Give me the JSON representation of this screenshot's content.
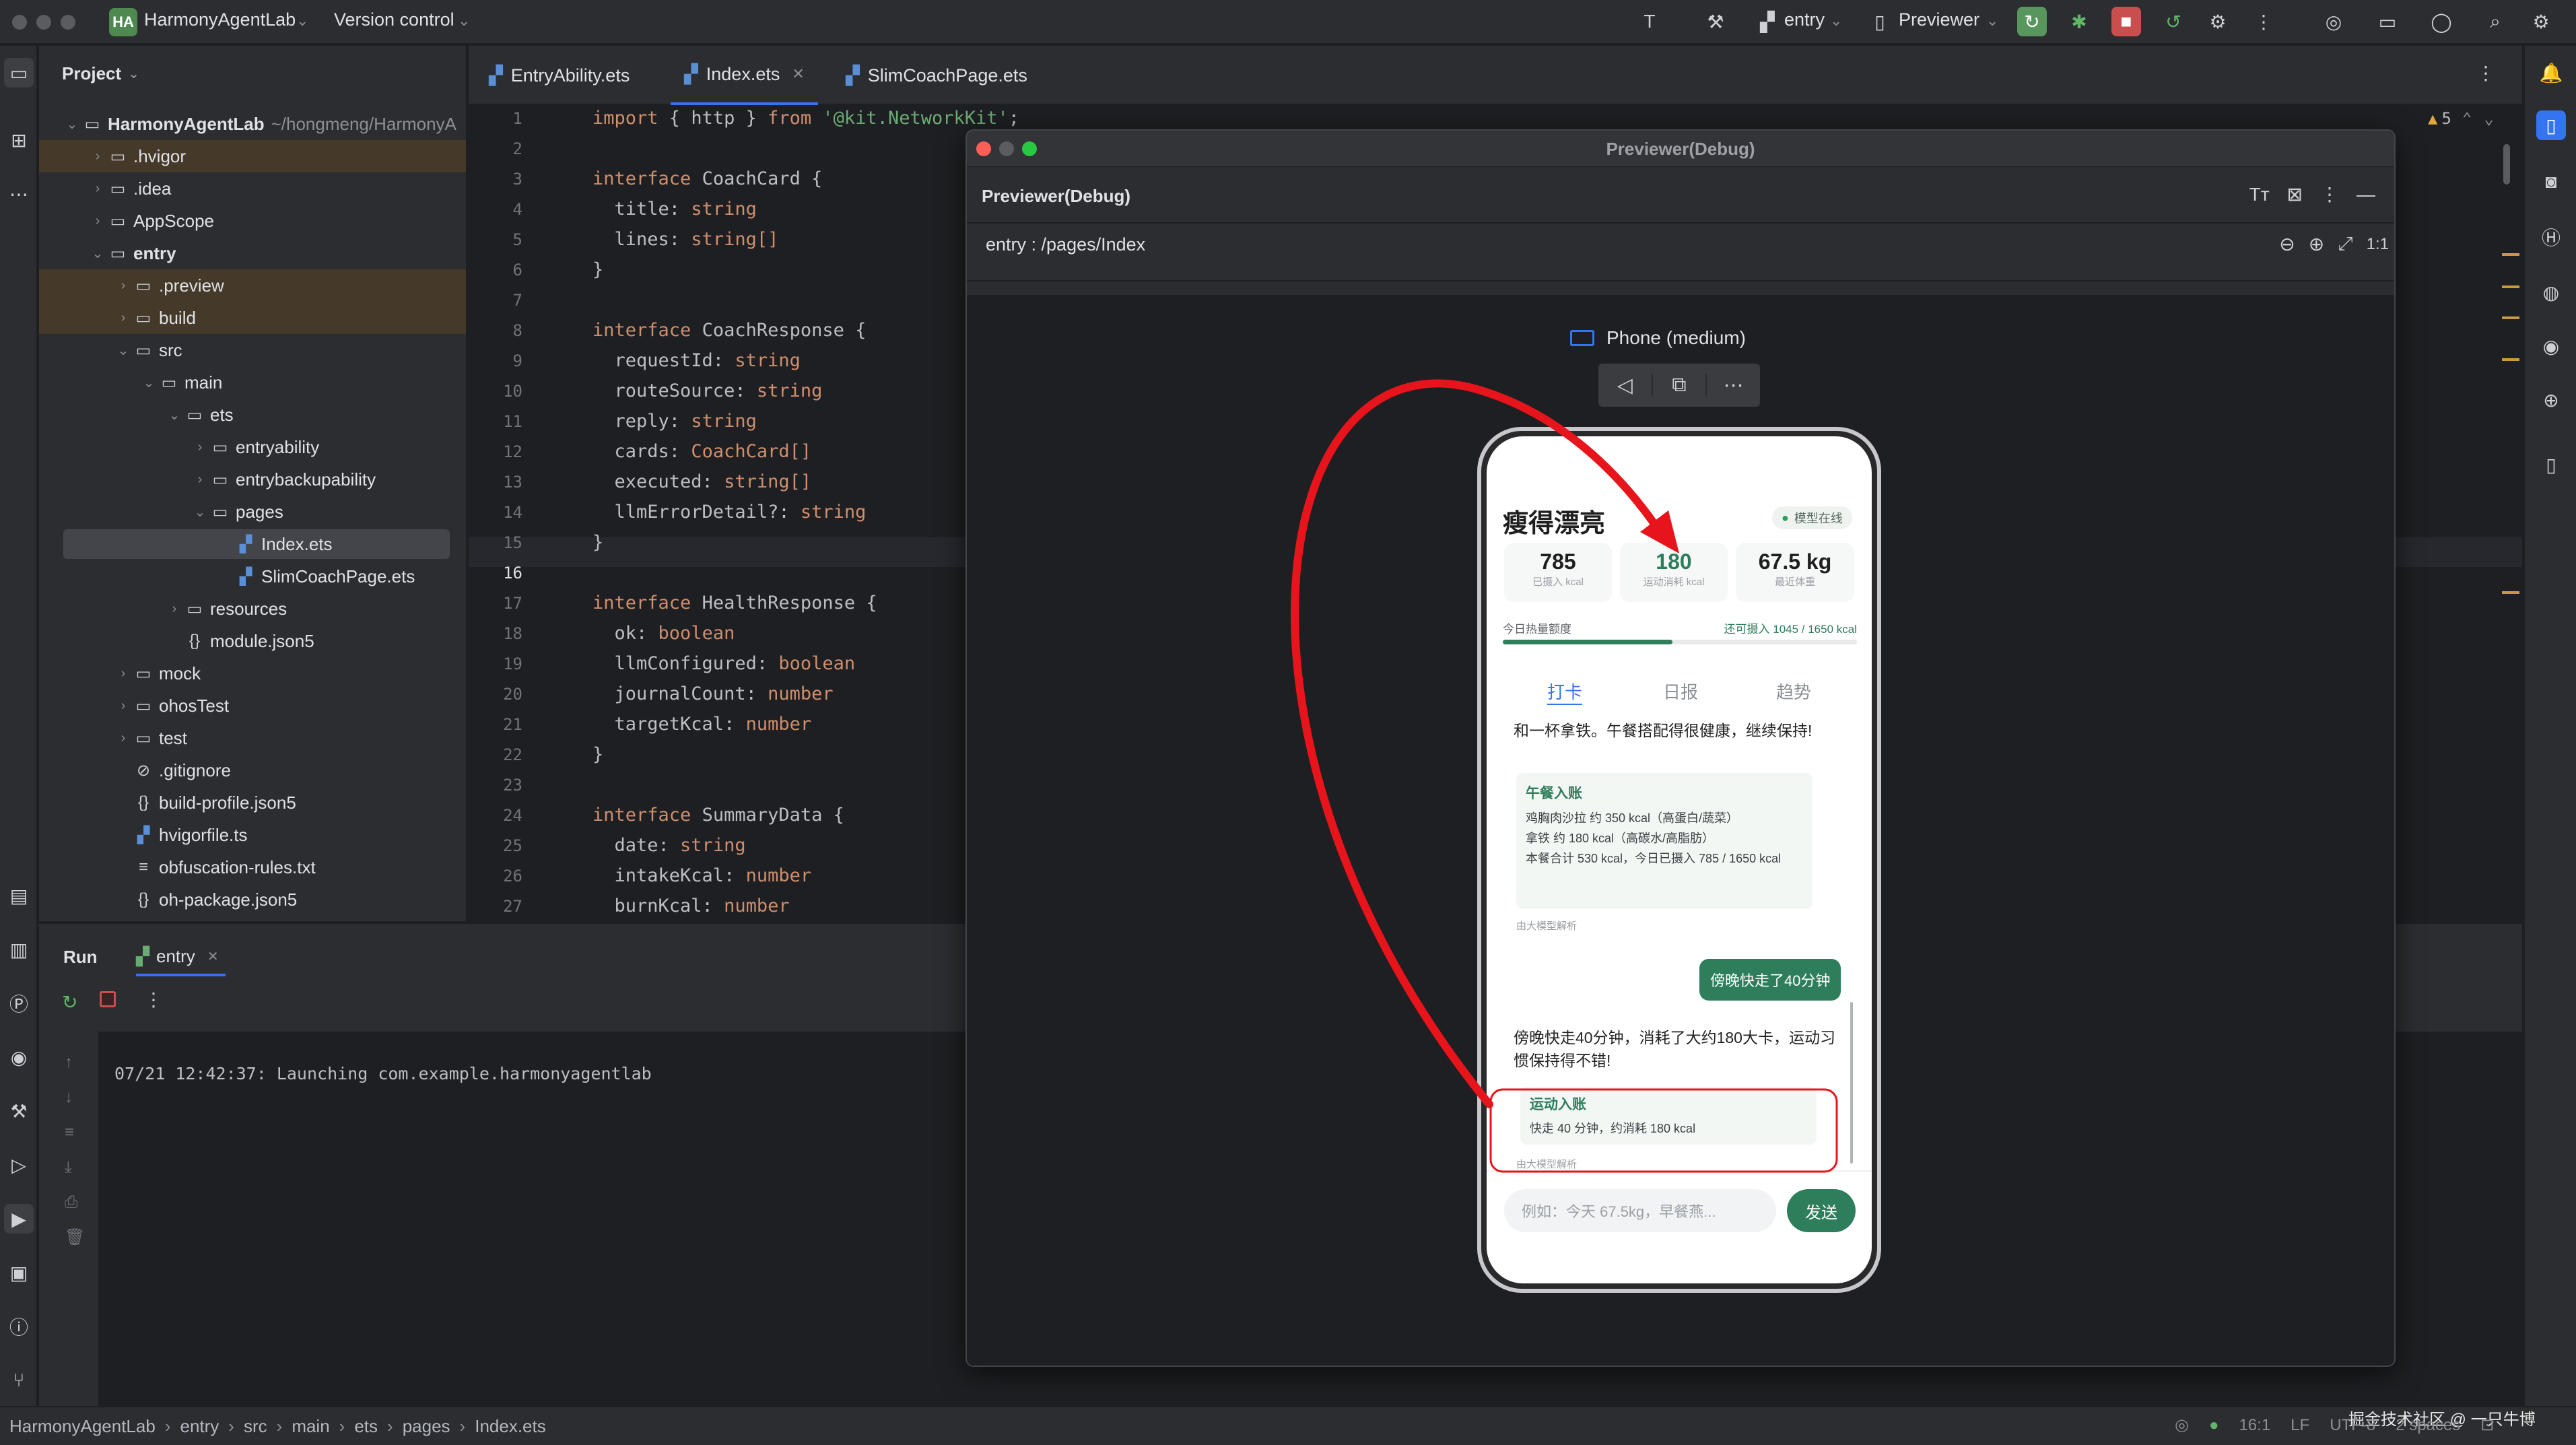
{
  "titlebar": {
    "project_badge": "HA",
    "project_name": "HarmonyAgentLab",
    "version_control": "Version control",
    "run_config": "entry",
    "previewer": "Previewer"
  },
  "project_panel": {
    "title": "Project",
    "root_name": "HarmonyAgentLab",
    "root_path": "~/hongmeng/HarmonyA",
    "items": [
      {
        "label": ".hvigor"
      },
      {
        "label": ".idea"
      },
      {
        "label": "AppScope"
      },
      {
        "label": "entry"
      },
      {
        "label": ".preview"
      },
      {
        "label": "build"
      },
      {
        "label": "src"
      },
      {
        "label": "main"
      },
      {
        "label": "ets"
      },
      {
        "label": "entryability"
      },
      {
        "label": "entrybackupability"
      },
      {
        "label": "pages"
      },
      {
        "label": "Index.ets"
      },
      {
        "label": "SlimCoachPage.ets"
      },
      {
        "label": "resources"
      },
      {
        "label": "module.json5"
      },
      {
        "label": "mock"
      },
      {
        "label": "ohosTest"
      },
      {
        "label": "test"
      },
      {
        "label": ".gitignore"
      },
      {
        "label": "build-profile.json5"
      },
      {
        "label": "hvigorfile.ts"
      },
      {
        "label": "obfuscation-rules.txt"
      },
      {
        "label": "oh-package.json5"
      }
    ]
  },
  "editor": {
    "tabs": [
      {
        "label": "EntryAbility.ets"
      },
      {
        "label": "Index.ets"
      },
      {
        "label": "SlimCoachPage.ets"
      }
    ],
    "warnings": "5",
    "lines": [
      {
        "n": "1",
        "t": "import { http } from '@kit.NetworkKit';"
      },
      {
        "n": "2",
        "t": ""
      },
      {
        "n": "3",
        "t": "interface CoachCard {"
      },
      {
        "n": "4",
        "t": "  title: string"
      },
      {
        "n": "5",
        "t": "  lines: string[]"
      },
      {
        "n": "6",
        "t": "}"
      },
      {
        "n": "7",
        "t": ""
      },
      {
        "n": "8",
        "t": "interface CoachResponse {"
      },
      {
        "n": "9",
        "t": "  requestId: string"
      },
      {
        "n": "10",
        "t": "  routeSource: string"
      },
      {
        "n": "11",
        "t": "  reply: string"
      },
      {
        "n": "12",
        "t": "  cards: CoachCard[]"
      },
      {
        "n": "13",
        "t": "  executed: string[]"
      },
      {
        "n": "14",
        "t": "  llmErrorDetail?: string"
      },
      {
        "n": "15",
        "t": "}"
      },
      {
        "n": "16",
        "t": ""
      },
      {
        "n": "17",
        "t": "interface HealthResponse {"
      },
      {
        "n": "18",
        "t": "  ok: boolean"
      },
      {
        "n": "19",
        "t": "  llmConfigured: boolean"
      },
      {
        "n": "20",
        "t": "  journalCount: number"
      },
      {
        "n": "21",
        "t": "  targetKcal: number"
      },
      {
        "n": "22",
        "t": "}"
      },
      {
        "n": "23",
        "t": ""
      },
      {
        "n": "24",
        "t": "interface SummaryData {"
      },
      {
        "n": "25",
        "t": "  date: string"
      },
      {
        "n": "26",
        "t": "  intakeKcal: number"
      },
      {
        "n": "27",
        "t": "  burnKcal: number"
      }
    ]
  },
  "run_panel": {
    "title": "Run",
    "tab": "entry",
    "console": "07/21 12:42:37: Launching com.example.harmonyagentlab"
  },
  "previewer": {
    "window_title": "Previewer(Debug)",
    "panel_title": "Previewer(Debug)",
    "path": "entry : /pages/Index",
    "zoom_label": "1:1",
    "device": "Phone (medium)"
  },
  "phone_app": {
    "title": "瘦得漂亮",
    "status": "模型在线",
    "stats": [
      {
        "value": "785",
        "label": "已摄入 kcal"
      },
      {
        "value": "180",
        "label": "运动消耗 kcal"
      },
      {
        "value": "67.5 kg",
        "label": "最近体重"
      }
    ],
    "budget_label": "今日热量额度",
    "budget_value": "还可摄入 1045 / 1650 kcal",
    "budget_fraction": 0.48,
    "tabs": [
      "打卡",
      "日报",
      "趋势"
    ],
    "msg1": "和一杯拿铁。午餐搭配得很健康，继续保持!",
    "card1": {
      "title": "午餐入账",
      "lines": [
        "鸡胸肉沙拉 约 350 kcal（高蛋白/蔬菜）",
        "拿铁 约 180 kcal（高碳水/高脂肪）",
        "本餐合计 530 kcal，今日已摄入 785 / 1650 kcal"
      ],
      "note": "由大模型解析"
    },
    "user_msg": "傍晚快走了40分钟",
    "msg2": "傍晚快走40分钟，消耗了大约180大卡，运动习惯保持得不错!",
    "card2": {
      "title": "运动入账",
      "lines": [
        "快走 40 分钟，约消耗 180 kcal"
      ],
      "note": "由大模型解析"
    },
    "input_placeholder": "例如：今天 67.5kg，早餐燕...",
    "send_label": "发送"
  },
  "statusbar": {
    "crumbs": [
      "HarmonyAgentLab",
      "entry",
      "src",
      "main",
      "ets",
      "pages",
      "Index.ets"
    ],
    "position": "16:1",
    "line_sep": "LF",
    "encoding": "UTF-8",
    "indent": "2 spaces",
    "watermark": "掘金技术社区 @ 一只牛博"
  },
  "colors": {
    "accent_green": "#2e7d5b",
    "annotation_red": "#e8141b",
    "ide_bg": "#1e1f22",
    "panel_bg": "#2b2d30"
  }
}
